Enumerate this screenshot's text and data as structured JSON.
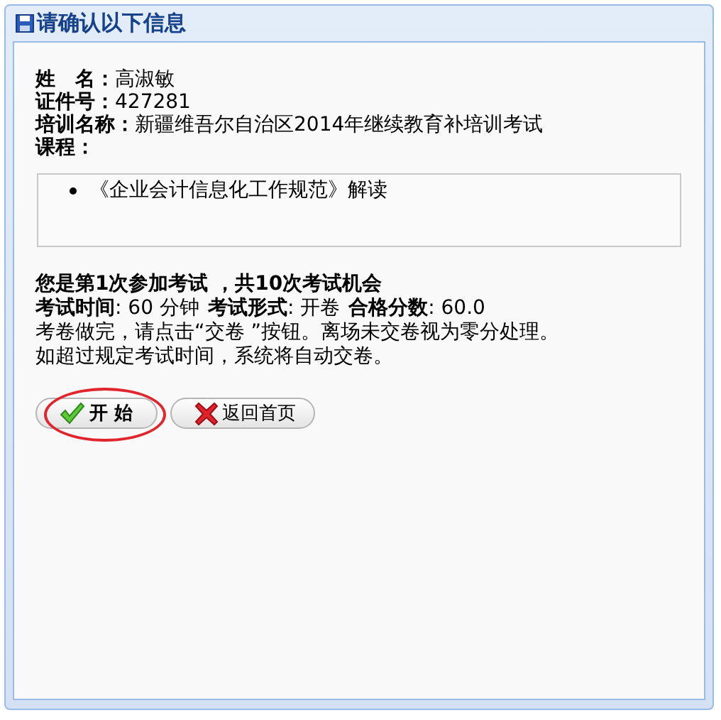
{
  "window": {
    "title": "请确认以下信息"
  },
  "fields": [
    {
      "label": "姓　名：",
      "value": "高淑敏"
    },
    {
      "label": "证件号：",
      "value": "427281"
    },
    {
      "label": "培训名称：",
      "value": "新疆维吾尔自治区2014年继续教育补培训考试"
    },
    {
      "label": "课程："
    }
  ],
  "courses": [
    "《企业会计信息化工作规范》解读"
  ],
  "attempt_notice": "您是第1次参加考试 ，共10次考试机会",
  "exam_info": [
    {
      "label": "考试时间",
      "value": ": 60 分钟"
    },
    {
      "label": "考试形式",
      "value": ": 开卷"
    },
    {
      "label": "合格分数",
      "value": ": 60.0"
    }
  ],
  "notes": [
    "考卷做完，请点击“交卷 ”按钮。离场未交卷视为零分处理。",
    "如超过规定考试时间，系统将自动交卷。"
  ],
  "buttons": [
    {
      "kind": "start",
      "label": "开 始",
      "highlighted": true
    },
    {
      "kind": "home",
      "label": "返回首页",
      "highlighted": false
    }
  ]
}
